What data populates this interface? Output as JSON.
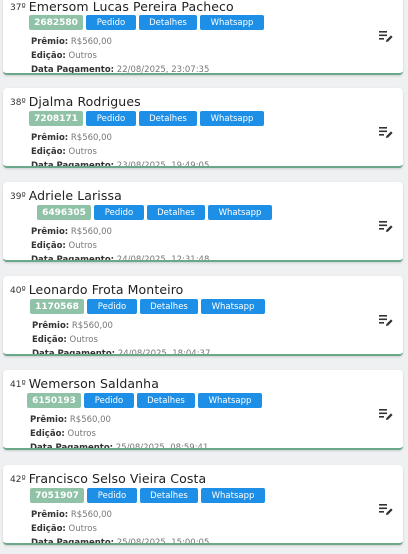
{
  "labels": {
    "premio": "Prêmio:",
    "edicao": "Edição:",
    "data_pagamento": "Data Pagamento:",
    "pedido": "Pedido",
    "detalhes": "Detalhes",
    "whatsapp": "Whatsapp"
  },
  "colors": {
    "code_badge": "#8fc2a6",
    "button": "#1e8fe6",
    "card_border": "#6aa88a"
  },
  "icons": {
    "edit": "edit-list-icon"
  },
  "entries": [
    {
      "rank": "37º",
      "name": "Emersom Lucas Pereira Pacheco",
      "code": "2682580",
      "premio": "R$560,00",
      "edicao": "Outros",
      "data_pagamento": "22/08/2025, 23:07:35"
    },
    {
      "rank": "38º",
      "name": "Djalma Rodrigues",
      "code": "7208171",
      "premio": "R$560,00",
      "edicao": "Outros",
      "data_pagamento": "23/08/2025, 19:49:05"
    },
    {
      "rank": "39º",
      "name": "Adriele Larissa",
      "code": "6496305",
      "premio": "R$560,00",
      "edicao": "Outros",
      "data_pagamento": "24/08/2025, 12:31:48"
    },
    {
      "rank": "40º",
      "name": "Leonardo Frota Monteiro",
      "code": "1170568",
      "premio": "R$560,00",
      "edicao": "Outros",
      "data_pagamento": "24/08/2025, 18:04:37"
    },
    {
      "rank": "41º",
      "name": "Wemerson Saldanha",
      "code": "6150193",
      "premio": "R$560,00",
      "edicao": "Outros",
      "data_pagamento": "25/08/2025, 08:59:41"
    },
    {
      "rank": "42º",
      "name": "Francisco Selso Vieira Costa",
      "code": "7051907",
      "premio": "R$560,00",
      "edicao": "Outros",
      "data_pagamento": "25/08/2025, 15:00:05"
    }
  ]
}
